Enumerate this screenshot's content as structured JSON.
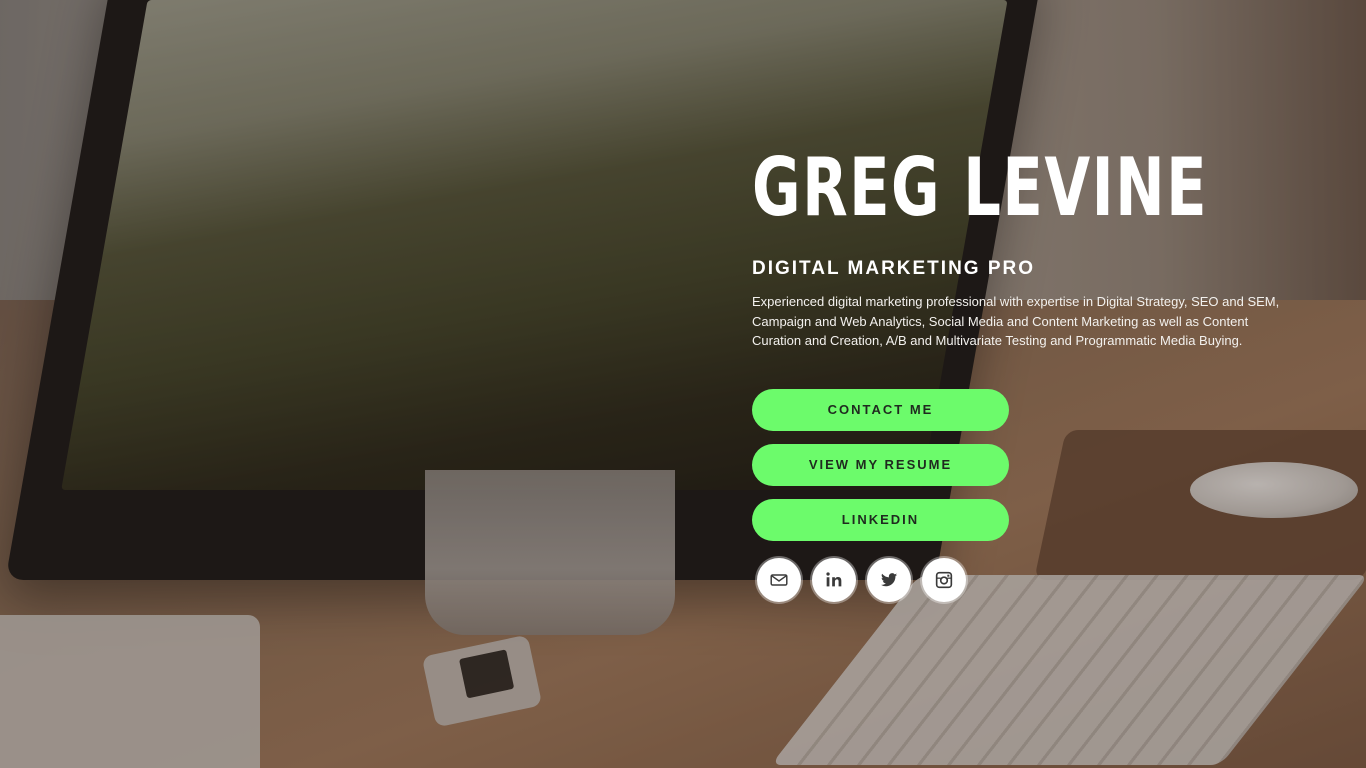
{
  "hero": {
    "name": "GREG LEVINE",
    "title": "DIGITAL MARKETING PRO",
    "description": "Experienced digital marketing professional with expertise in Digital Strategy, SEO and SEM, Campaign and Web Analytics, Social Media and Content Marketing as well as Content Curation and Creation, A/B and Multivariate Testing and Programmatic Media Buying."
  },
  "buttons": {
    "contact": "CONTACT ME",
    "resume": "VIEW MY RESUME",
    "linkedin": "LINKEDIN"
  },
  "social": [
    {
      "icon": "email-icon"
    },
    {
      "icon": "linkedin-icon"
    },
    {
      "icon": "twitter-icon"
    },
    {
      "icon": "instagram-icon"
    }
  ],
  "colors": {
    "accent": "#6cfb6b",
    "button_text": "#1f2a1f",
    "text": "#ffffff"
  }
}
